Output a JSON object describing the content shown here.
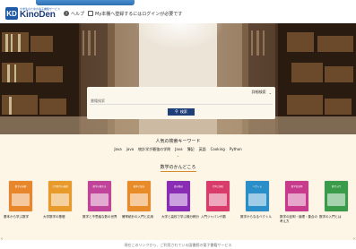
{
  "header": {
    "logo_sub": "大学生のための電子書籍サービス",
    "logo_main": "KinoDen",
    "help": "ヘルプ",
    "my_bookshelf": "My本棚へ登録するにはログインが必要です"
  },
  "search": {
    "type_label": "詳細検索",
    "placeholder": "書籍検索",
    "button": "検索"
  },
  "popular": {
    "title": "人気の検索キーワード",
    "keywords": [
      "Java",
      "java",
      "統計学が最強の学問",
      "Java",
      "簿記",
      "英語",
      "Cooking",
      "Python"
    ]
  },
  "math": {
    "title": "数学のかんどころ",
    "books": [
      {
        "cover_text": "数学の基礎",
        "color": "#e8862b",
        "title": "基本から学ぶ数学"
      },
      {
        "cover_text": "大学数学の基礎",
        "color": "#e89a2b",
        "title": "大学数学の基礎"
      },
      {
        "cover_text": "数学の教え方",
        "color": "#c0459a",
        "title": "数学と不思議な数の世界"
      },
      {
        "cover_text": "確率と統計",
        "color": "#e88c2a",
        "title": "確率統計の入門と応用"
      },
      {
        "cover_text": "微分積分",
        "color": "#8a2db5",
        "title": "大学と高校で学ぶ微分積分"
      },
      {
        "cover_text": "行列と線形",
        "color": "#d93b6b",
        "title": "入門ジャパン代数"
      },
      {
        "cover_text": "ベクトル",
        "color": "#2a8fc8",
        "title": "数学からなるベクトル"
      },
      {
        "cover_text": "数学的証明",
        "color": "#c73a8c",
        "title": "数学の証明・論理・集合の考え方"
      },
      {
        "cover_text": "数学入門",
        "color": "#3a9c4a",
        "title": "数学の入門とは"
      }
    ]
  },
  "footer": {
    "text": "現在このリンクから、ご利用されている図書館の電子書籍サービス"
  }
}
